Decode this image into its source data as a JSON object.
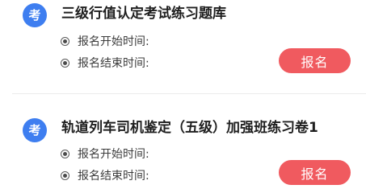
{
  "colors": {
    "badge": "#3e7ef0",
    "button": "#f05a5f",
    "title": "#1f1f1f",
    "text": "#3c3c3c",
    "divider": "#ececec"
  },
  "exams": [
    {
      "badge": "考",
      "title": "三级行值认定考试练习题库",
      "start_label": "报名开始时间:",
      "end_label": "报名结束时间:",
      "button_label": "报名",
      "row_icon": "radio-dot-icon"
    },
    {
      "badge": "考",
      "title": "轨道列车司机鉴定（五级）加强班练习卷1",
      "start_label": "报名开始时间:",
      "end_label": "报名结束时间:",
      "button_label": "报名",
      "row_icon": "radio-dot-icon"
    }
  ]
}
